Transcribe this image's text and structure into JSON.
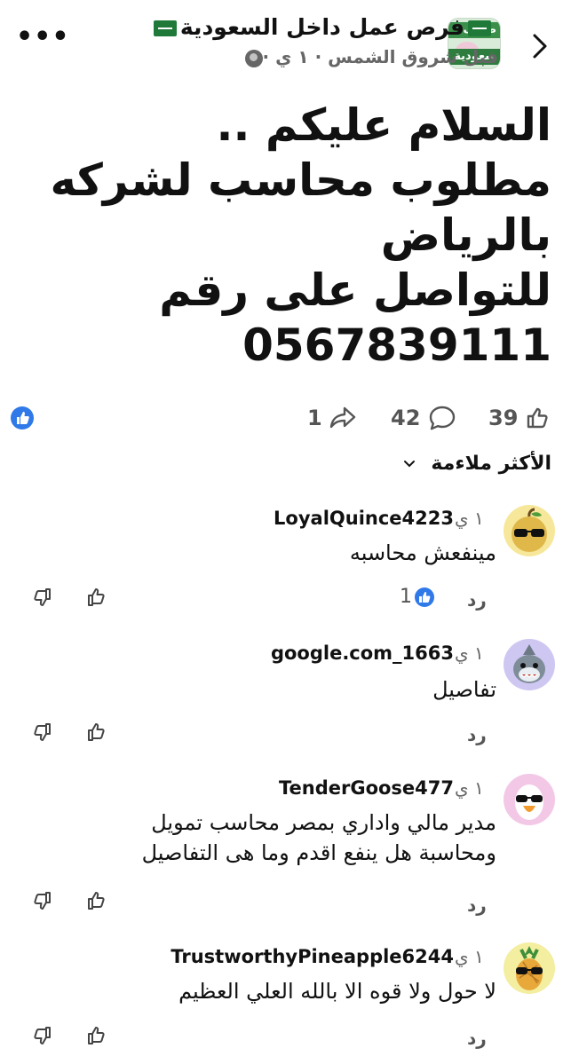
{
  "header": {
    "title": "فرص عمل داخل السعودية",
    "subtitle": "قبل شروق الشمس · ١ ي ·",
    "avatar_text_top": "طائف",
    "avatar_text_bottom": "سعودية"
  },
  "post": {
    "body": "السلام عليكم ..\nمطلوب محاسب لشركه\nبالرياض\nللتواصل على رقم\n0567839111"
  },
  "stats": {
    "likes": "39",
    "comments": "42",
    "shares": "1"
  },
  "sort": {
    "label": "الأكثر ملاءمة"
  },
  "comments": [
    {
      "author": "LoyalQuince4223",
      "time": "١ ي",
      "text": "مينفعش محاسبه",
      "reply_label": "رد",
      "likes": "1"
    },
    {
      "author": "google.com_1663",
      "time": "١ ي",
      "text": "تفاصيل",
      "reply_label": "رد",
      "likes": ""
    },
    {
      "author": "TenderGoose477",
      "time": "١ ي",
      "text": "مدير مالي واداري بمصر محاسب تمويل\nومحاسبة هل ينفع اقدم وما هى التفاصيل",
      "reply_label": "رد",
      "likes": ""
    },
    {
      "author": "TrustworthyPineapple6244",
      "time": "١ ي",
      "text": "لا حول ولا قوه الا بالله العلي العظيم",
      "reply_label": "رد",
      "likes": ""
    }
  ],
  "colors": {
    "accent": "#2f79e8",
    "muted": "#666666",
    "flag_green": "#1f7a3a"
  }
}
